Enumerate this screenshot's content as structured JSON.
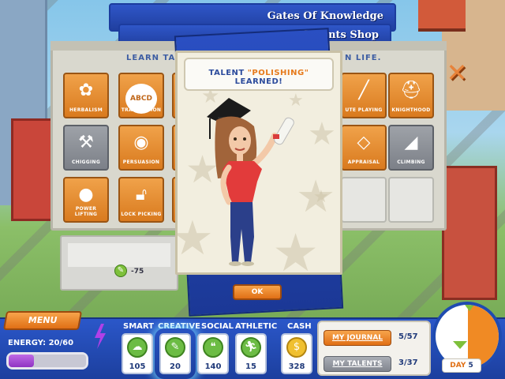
{
  "header": {
    "card1_title": "Gates Of Knowledge",
    "card2_title": "Talents Shop"
  },
  "book": {
    "title_left": "LEARN TALE",
    "title_right": "N LIFE.",
    "close_label": "✕",
    "tiles": [
      {
        "label": "HERBALISM",
        "icon": "flower-icon",
        "state": "orange"
      },
      {
        "label": "TRANSLATION",
        "icon": "abcd-bubble-icon",
        "state": "orange"
      },
      {
        "label": "UTE PLAYING",
        "icon": "flute-icon",
        "state": "orange"
      },
      {
        "label": "KNIGHTHOOD",
        "icon": "helmet-icon",
        "state": "orange"
      },
      {
        "label": "CHIGGING",
        "icon": "hammer-icon",
        "state": "gray"
      },
      {
        "label": "PERSUASION",
        "icon": "eye-icon",
        "state": "orange"
      },
      {
        "label": "APPRAISAL",
        "icon": "diamond-icon",
        "state": "orange"
      },
      {
        "label": "CLIMBING",
        "icon": "climbing-icon",
        "state": "gray"
      },
      {
        "label": "POWER LIFTING",
        "icon": "kettlebell-icon",
        "state": "orange"
      },
      {
        "label": "LOCK PICKING",
        "icon": "lock-icon",
        "state": "orange"
      }
    ],
    "skill_cost": "-75"
  },
  "popup": {
    "title_prefix": "TALENT ",
    "talent_name": "\"POLISHING\"",
    "title_suffix": " LEARNED!",
    "ok_label": "OK"
  },
  "hud": {
    "menu_label": "MENU",
    "energy_label": "ENERGY: 20/60",
    "energy_fraction": 0.33,
    "stats": [
      {
        "head": "SMART",
        "value": "105",
        "icon": "brain-icon"
      },
      {
        "head": "CREATIVE",
        "value": "20",
        "icon": "pencil-icon"
      },
      {
        "head": "SOCIAL",
        "value": "140",
        "icon": "speech-bubbles-icon"
      },
      {
        "head": "ATHLETIC",
        "value": "15",
        "icon": "running-figure-icon"
      },
      {
        "head": "CASH",
        "value": "328",
        "icon": "dollar-icon"
      }
    ],
    "journal_label": "MY JOURNAL",
    "journal_count": "5/57",
    "talents_label": "MY TALENTS",
    "talents_count": "3/37",
    "day_label": "DAY",
    "day_value": "5",
    "colors": {
      "accent": "#e06f15",
      "primary": "#2b57c9",
      "energy": "#8f33c2"
    }
  }
}
